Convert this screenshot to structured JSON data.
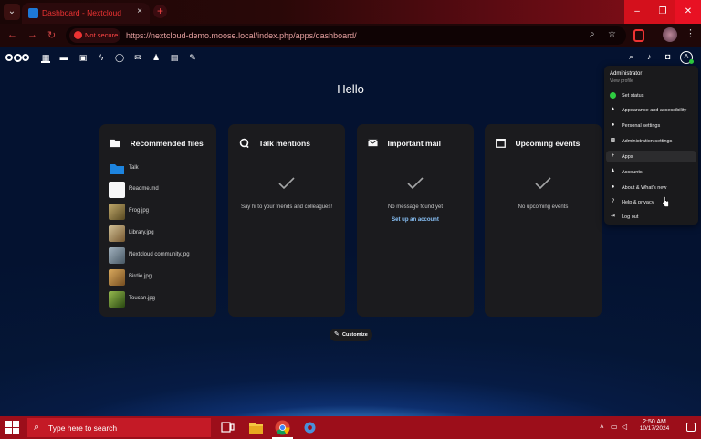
{
  "browser": {
    "tab_title": "Dashboard - Nextcloud",
    "tab_close": "×",
    "new_tab": "+",
    "security_label": "Not secure",
    "url": "https://nextcloud-demo.moose.local/index.php/apps/dashboard/",
    "window_controls": [
      "–",
      "❐",
      "✕"
    ]
  },
  "page": {
    "greeting": "Hello",
    "customize_label": "Customize"
  },
  "widgets": {
    "recommended": {
      "title": "Recommended files",
      "files": [
        {
          "name": "Talk",
          "thumb_color": "#1e88e5"
        },
        {
          "name": "Readme.md",
          "thumb_color": "#ffffff"
        },
        {
          "name": "Frog.jpg",
          "thumb_color": "#8a7a3a"
        },
        {
          "name": "Library.jpg",
          "thumb_color": "#b59a6a"
        },
        {
          "name": "Nextcloud community.jpg",
          "thumb_color": "#8aa0b0"
        },
        {
          "name": "Birdie.jpg",
          "thumb_color": "#c49a50"
        },
        {
          "name": "Toucan.jpg",
          "thumb_color": "#6a9a30"
        }
      ]
    },
    "talk": {
      "title": "Talk mentions",
      "empty": "Say hi to your friends and colleagues!"
    },
    "mail": {
      "title": "Important mail",
      "empty": "No message found yet",
      "action": "Set up an account"
    },
    "events": {
      "title": "Upcoming events",
      "empty": "No upcoming events"
    }
  },
  "user_menu": {
    "name": "Administrator",
    "view_profile": "View profile",
    "items": [
      {
        "label": "Set status",
        "icon": "status-dot-icon"
      },
      {
        "label": "Appearance and accessibility",
        "icon": "appearance-icon"
      },
      {
        "label": "Personal settings",
        "icon": "person-icon"
      },
      {
        "label": "Administration settings",
        "icon": "admin-settings-icon"
      },
      {
        "label": "Apps",
        "icon": "plus-icon"
      },
      {
        "label": "Accounts",
        "icon": "accounts-icon"
      },
      {
        "label": "About & What's new",
        "icon": "info-icon"
      },
      {
        "label": "Help & privacy",
        "icon": "help-icon"
      },
      {
        "label": "Log out",
        "icon": "logout-icon"
      }
    ],
    "hovered_item": "Apps",
    "avatar_letter": "A"
  },
  "taskbar": {
    "search_placeholder": "Type here to search",
    "time": "2:50 AM",
    "date": "10/17/2024"
  },
  "colors": {
    "accent_red": "#d4101c",
    "taskbar_red": "#9c0e1a",
    "link_blue": "#8ec8ff",
    "status_green": "#2ecc40"
  }
}
